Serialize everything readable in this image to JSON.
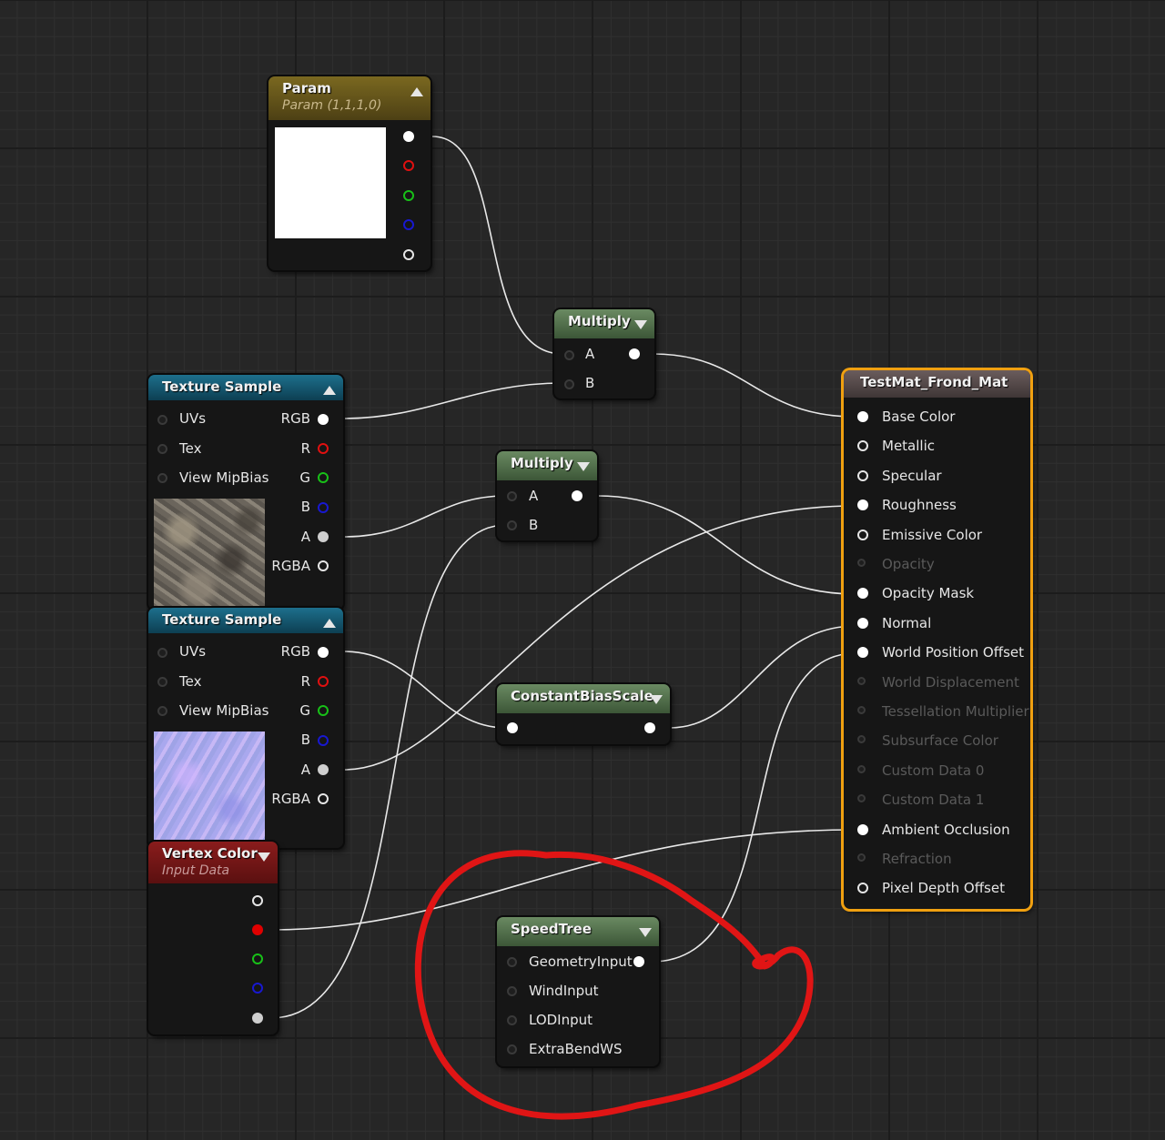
{
  "colors": {
    "param_header": "#5a4c15",
    "texture_header": "#0f4f66",
    "multiply_header": "#3f5c3a",
    "vertex_header": "#6b1414",
    "result_border": "#f0a010",
    "result_header": "#4a4040",
    "annotation_red": "#e01515"
  },
  "param": {
    "title": "Param",
    "subtitle": "Param (1,1,1,0)"
  },
  "multiply_top": {
    "title": "Multiply",
    "in_a": "A",
    "in_b": "B"
  },
  "multiply_mid": {
    "title": "Multiply",
    "in_a": "A",
    "in_b": "B"
  },
  "texture_1": {
    "title": "Texture Sample",
    "inputs": [
      "UVs",
      "Tex",
      "View MipBias"
    ],
    "outputs": [
      "RGB",
      "R",
      "G",
      "B",
      "A",
      "RGBA"
    ]
  },
  "texture_2": {
    "title": "Texture Sample",
    "inputs": [
      "UVs",
      "Tex",
      "View MipBias"
    ],
    "outputs": [
      "RGB",
      "R",
      "G",
      "B",
      "A",
      "RGBA"
    ]
  },
  "constant_bias_scale": {
    "title": "ConstantBiasScale"
  },
  "vertex_color": {
    "title": "Vertex Color",
    "subtitle": "Input Data"
  },
  "speedtree": {
    "title": "SpeedTree",
    "inputs": [
      "GeometryInput",
      "WindInput",
      "LODInput",
      "ExtraBendWS"
    ]
  },
  "material": {
    "title": "TestMat_Frond_Mat",
    "inputs": [
      {
        "label": "Base Color",
        "active": true
      },
      {
        "label": "Metallic",
        "active": true
      },
      {
        "label": "Specular",
        "active": true
      },
      {
        "label": "Roughness",
        "active": true
      },
      {
        "label": "Emissive Color",
        "active": true
      },
      {
        "label": "Opacity",
        "active": false
      },
      {
        "label": "Opacity Mask",
        "active": true
      },
      {
        "label": "Normal",
        "active": true
      },
      {
        "label": "World Position Offset",
        "active": true
      },
      {
        "label": "World Displacement",
        "active": false
      },
      {
        "label": "Tessellation Multiplier",
        "active": false
      },
      {
        "label": "Subsurface Color",
        "active": false
      },
      {
        "label": "Custom Data 0",
        "active": false
      },
      {
        "label": "Custom Data 1",
        "active": false
      },
      {
        "label": "Ambient Occlusion",
        "active": true
      },
      {
        "label": "Refraction",
        "active": false
      },
      {
        "label": "Pixel Depth Offset",
        "active": true
      }
    ]
  }
}
